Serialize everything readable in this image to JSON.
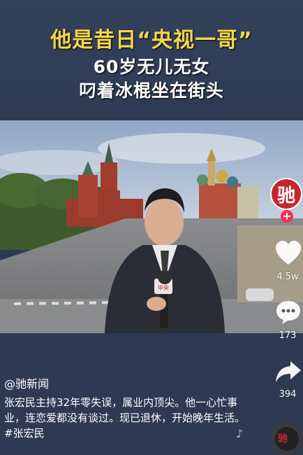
{
  "overlay": {
    "title_line1": "他是昔日“央视一哥”",
    "title_line2": "60岁无儿无女",
    "title_line3": "叼着冰棍坐在街头"
  },
  "post": {
    "author": "@驰新闻",
    "caption": "张宏民主持32年零失误，属业内顶尖。他一心忙事业，连恋爱都没有谈过。现已退休，开始晚年生活。",
    "hashtag": "#张宏民"
  },
  "sidebar": {
    "avatar_char": "驰",
    "follow_symbol": "+",
    "likes": "4.5w",
    "comments": "173",
    "shares": "394",
    "disc_char": "驰"
  },
  "video": {
    "mic_label": "中央"
  },
  "colors": {
    "title_yellow": "#f6d64a",
    "background": "#2d3a52",
    "avatar_red": "#c7252e",
    "follow_pink": "#fe2c55"
  }
}
